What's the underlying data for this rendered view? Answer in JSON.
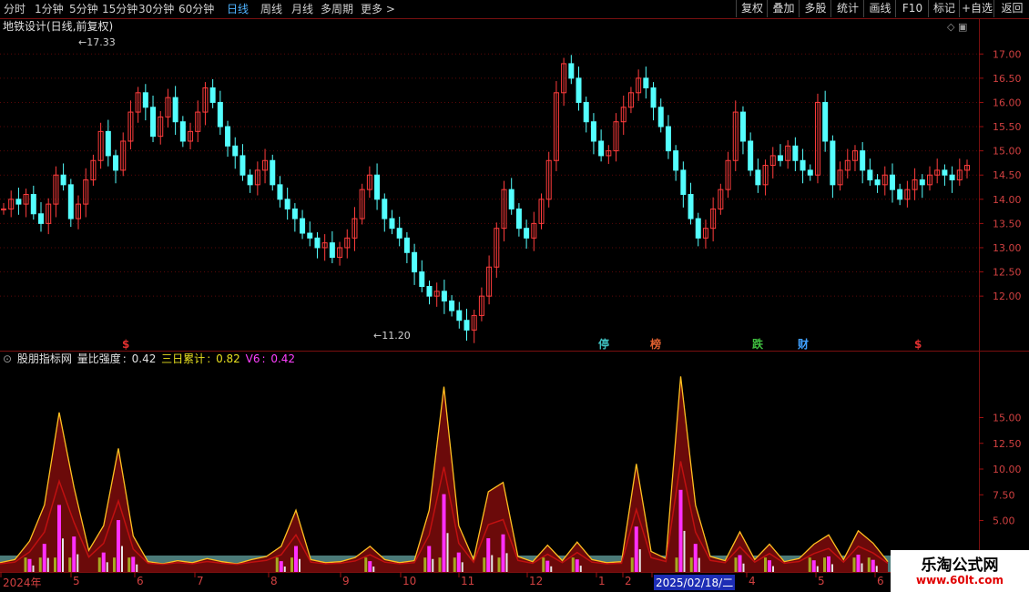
{
  "toolbar": {
    "periods": [
      "分时",
      "1分钟",
      "5分钟",
      "15分钟",
      "30分钟",
      "60分钟",
      "日线",
      "周线",
      "月线",
      "多周期",
      "更多"
    ],
    "active_period": "日线",
    "right_buttons": [
      "复权",
      "叠加",
      "多股",
      "统计",
      "画线",
      "F10",
      "标记",
      "+自选",
      "返回"
    ]
  },
  "panel1": {
    "title": "地铁设计(日线,前复权)",
    "high_label": "17.33",
    "low_label": "11.20",
    "markers": [
      {
        "text": "$",
        "color": "#e03030"
      },
      {
        "text": "停",
        "color": "#40c0c0"
      },
      {
        "text": "榜",
        "color": "#e06030"
      },
      {
        "text": "跌",
        "color": "#40c040"
      },
      {
        "text": "财",
        "color": "#40a0ff"
      },
      {
        "text": "$",
        "color": "#e03030"
      }
    ]
  },
  "panel2": {
    "title": "股朋指标网",
    "ind1_name": "量比强度",
    "ind1_value": "0.42",
    "ind2_name": "三日累计",
    "ind2_value": "0.82",
    "ind3_name": "V6",
    "ind3_value": "0.42"
  },
  "dates": [
    "2024年",
    "5",
    "6",
    "7",
    "8",
    "9",
    "10",
    "11",
    "12",
    "1",
    "2",
    "2025/02/18/二",
    "4",
    "5",
    "6"
  ],
  "watermark": {
    "title": "乐淘公式网",
    "url": "www.60lt.com"
  },
  "chart_data": [
    {
      "type": "candlestick",
      "title": "地铁设计(日线,前复权)",
      "y_ticks": [
        "17.00",
        "16.50",
        "16.00",
        "15.50",
        "15.00",
        "14.50",
        "14.00",
        "13.50",
        "13.00",
        "12.50",
        "12.00"
      ],
      "ylim": [
        11.1,
        17.4
      ],
      "annotations": {
        "max": 17.33,
        "min": 11.2
      },
      "close_series": [
        13.8,
        14.0,
        13.9,
        14.1,
        13.7,
        13.5,
        13.9,
        14.5,
        14.3,
        13.6,
        13.9,
        14.4,
        14.8,
        15.4,
        14.9,
        14.6,
        15.2,
        15.8,
        16.2,
        15.9,
        15.3,
        15.7,
        16.1,
        15.6,
        15.2,
        15.4,
        15.8,
        16.3,
        16.0,
        15.5,
        15.1,
        14.9,
        14.5,
        14.3,
        14.6,
        14.8,
        14.3,
        14.0,
        13.8,
        13.6,
        13.3,
        13.2,
        13.0,
        13.1,
        12.8,
        13.0,
        13.2,
        13.6,
        14.2,
        14.5,
        14.0,
        13.6,
        13.4,
        13.2,
        12.9,
        12.5,
        12.2,
        12.0,
        12.1,
        11.9,
        11.7,
        11.5,
        11.3,
        11.6,
        12.0,
        12.6,
        13.4,
        14.2,
        13.8,
        13.4,
        13.2,
        13.5,
        14.0,
        14.8,
        16.2,
        16.8,
        16.5,
        16.0,
        15.6,
        15.2,
        14.9,
        15.0,
        15.6,
        15.9,
        16.2,
        16.5,
        16.3,
        15.9,
        15.5,
        15.0,
        14.6,
        14.1,
        13.6,
        13.2,
        13.4,
        13.8,
        14.2,
        14.8,
        15.8,
        15.2,
        14.6,
        14.3,
        14.7,
        14.9,
        14.8,
        15.1,
        14.8,
        14.6,
        14.5,
        16.0,
        15.2,
        14.3,
        14.6,
        14.8,
        15.0,
        14.6,
        14.4,
        14.3,
        14.5,
        14.2,
        14.0,
        14.2,
        14.4,
        14.3,
        14.5,
        14.6,
        14.5,
        14.4,
        14.6,
        14.7
      ]
    },
    {
      "type": "bar+line",
      "title": "股朋指标网",
      "series": [
        {
          "name": "量比强度",
          "values": [
            0.9,
            1.2,
            3.0,
            6.5,
            15.5,
            8.2,
            2.1,
            4.5,
            12.0,
            3.5,
            1.0,
            0.8,
            1.1,
            0.9,
            1.3,
            1.0,
            0.8,
            1.2,
            1.5,
            2.5,
            6.0,
            1.2,
            0.9,
            1.0,
            1.4,
            2.5,
            1.2,
            0.9,
            1.1,
            6.0,
            18.0,
            4.5,
            1.2,
            7.8,
            8.7,
            1.5,
            1.0,
            2.6,
            1.1,
            2.9,
            1.2,
            0.9,
            1.0,
            10.5,
            2.0,
            1.3,
            19.0,
            6.5,
            1.5,
            1.1,
            3.9,
            1.2,
            2.7,
            1.0,
            1.3,
            2.7,
            3.6,
            1.2,
            4.0,
            2.8,
            1.0
          ]
        },
        {
          "name": "三日累计",
          "values": []
        },
        {
          "name": "V6",
          "values": []
        }
      ],
      "y_ticks": [
        "15.00",
        "12.50",
        "10.00",
        "7.50",
        "5.00"
      ],
      "ylim": [
        0,
        20
      ]
    }
  ]
}
